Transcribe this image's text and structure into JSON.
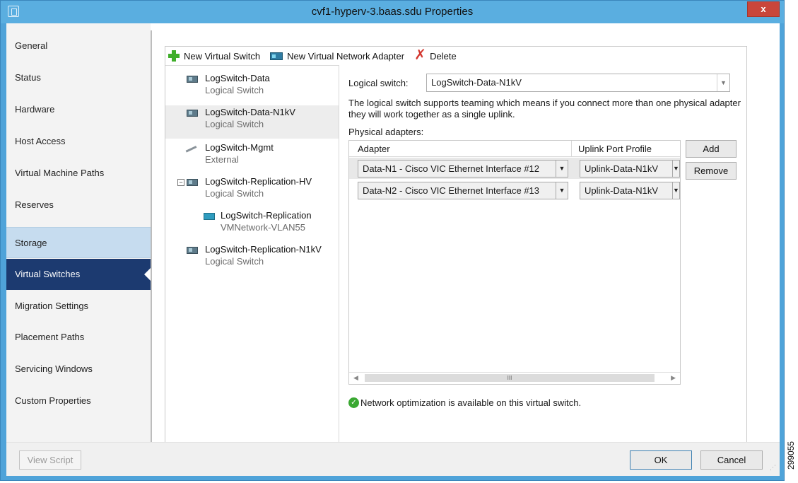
{
  "window": {
    "title": "cvf1-hyperv-3.baas.sdu Properties",
    "close_label": "x"
  },
  "nav": {
    "items": [
      {
        "label": "General"
      },
      {
        "label": "Status"
      },
      {
        "label": "Hardware"
      },
      {
        "label": "Host Access"
      },
      {
        "label": "Virtual Machine Paths"
      },
      {
        "label": "Reserves"
      },
      {
        "label": "Storage"
      },
      {
        "label": "Virtual Switches"
      },
      {
        "label": "Migration Settings"
      },
      {
        "label": "Placement Paths"
      },
      {
        "label": "Servicing Windows"
      },
      {
        "label": "Custom Properties"
      }
    ],
    "active": "Virtual Switches",
    "hovered": "Storage"
  },
  "toolbar": {
    "new_switch": "New Virtual Switch",
    "new_adapter": "New Virtual Network Adapter",
    "delete": "Delete",
    "delete_glyph": "✗"
  },
  "tree": {
    "items": [
      {
        "title": "LogSwitch-Data",
        "subtitle": "Logical Switch",
        "icon": "logical-switch-icon"
      },
      {
        "title": "LogSwitch-Data-N1kV",
        "subtitle": "Logical Switch",
        "icon": "logical-switch-icon",
        "selected": true
      },
      {
        "title": "LogSwitch-Mgmt",
        "subtitle": "External",
        "icon": "external-cable-icon"
      },
      {
        "title": "LogSwitch-Replication-HV",
        "subtitle": "Logical Switch",
        "icon": "logical-switch-icon",
        "expanded": true
      },
      {
        "title": "LogSwitch-Replication",
        "subtitle": "VMNetwork-VLAN55",
        "icon": "vm-network-adapter-icon"
      },
      {
        "title": "LogSwitch-Replication-N1kV",
        "subtitle": "Logical Switch",
        "icon": "logical-switch-icon"
      }
    ],
    "expander_glyph": "−"
  },
  "detail": {
    "logical_switch_label": "Logical switch:",
    "logical_switch_value": "LogSwitch-Data-N1kV",
    "description": "The logical switch supports teaming which means if you connect more than one physical adapter they will work together as a single uplink.",
    "physical_adapters_label": "Physical adapters:",
    "columns": [
      "Adapter",
      "Uplink Port Profile"
    ],
    "rows": [
      {
        "adapter": "Data-N1 - Cisco VIC Ethernet Interface #12",
        "profile": "Uplink-Data-N1kV"
      },
      {
        "adapter": "Data-N2 - Cisco VIC Ethernet Interface #13",
        "profile": "Uplink-Data-N1kV"
      }
    ],
    "scroll_thumb_glyph": "III",
    "add_label": "Add",
    "remove_label": "Remove",
    "note": "Network optimization is available on this virtual switch."
  },
  "footer": {
    "view_script": "View Script",
    "ok": "OK",
    "cancel": "Cancel"
  },
  "figure_number": "299055",
  "colors": {
    "titlebar": "#5aaee0",
    "nav_active": "#1c3a70",
    "nav_hover": "#c6dcef",
    "close": "#c9463b",
    "ok_check": "#3aa832"
  }
}
